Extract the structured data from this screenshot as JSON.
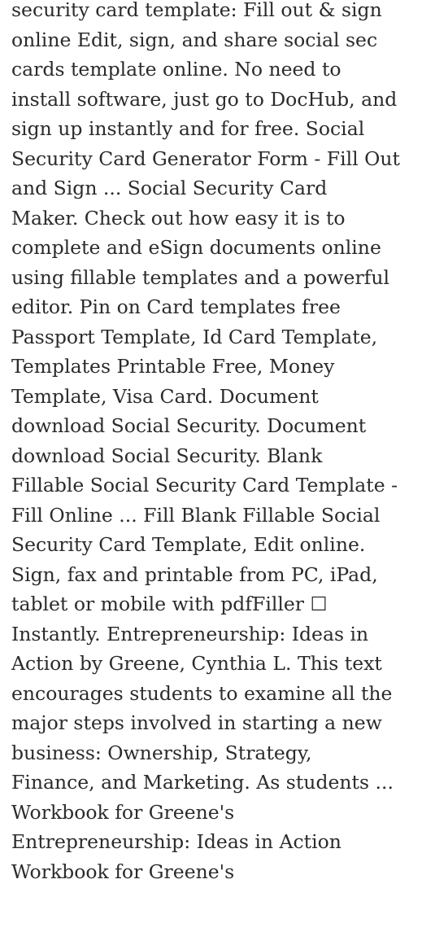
{
  "colors": {
    "background": "#ffffff",
    "text": "#2b2b2b"
  },
  "article": {
    "lines": [
      "security card template: Fill out & sign",
      "online Edit, sign, and share social sec",
      "cards template online. No need to",
      "install software, just go to DocHub, and",
      "sign up instantly and for free. Social",
      "Security Card Generator Form - Fill Out",
      "and Sign ... Social Security Card",
      "Maker. Check out how easy it is to",
      "complete and eSign documents online",
      "using fillable templates and a powerful",
      "editor. Pin on Card templates free",
      "Passport Template, Id Card Template,",
      "Templates Printable Free, Money",
      "Template, Visa Card. Document",
      "download Social Security. Document",
      "download Social Security. Blank",
      "Fillable Social Security Card Template -",
      "Fill Online ... Fill Blank Fillable Social",
      "Security Card Template, Edit online.",
      "Sign, fax and printable from PC, iPad,",
      "tablet or mobile with pdfFiller ☐",
      "Instantly. Entrepreneurship: Ideas in",
      "Action by Greene, Cynthia L. This text",
      "encourages students to examine all the",
      "major steps involved in starting a new",
      "business: Ownership, Strategy,",
      "Finance, and Marketing. As students ...",
      "Workbook for Greene's",
      "Entrepreneurship: Ideas in Action",
      "Workbook for Greene's"
    ]
  }
}
